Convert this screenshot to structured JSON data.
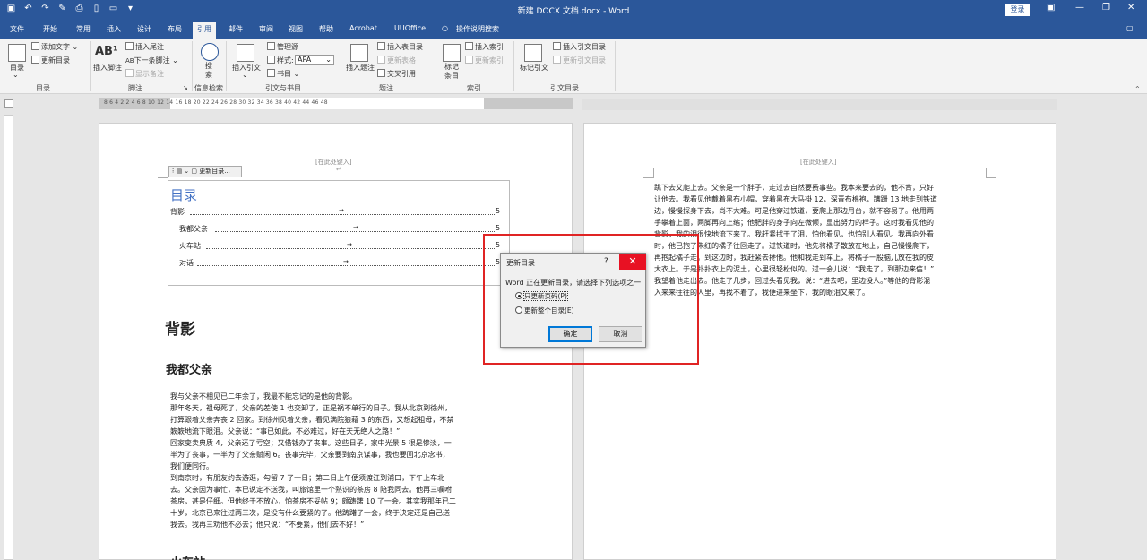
{
  "window": {
    "title": "新建 DOCX 文档.docx  -  Word",
    "login_label": "登录",
    "qat_icons": [
      "save-icon",
      "undo-icon",
      "redo-icon",
      "format-painter-icon",
      "print-preview-icon",
      "new-doc-icon",
      "open-icon",
      "more-icon"
    ]
  },
  "tabs": [
    "文件",
    "开始",
    "常用",
    "插入",
    "设计",
    "布局",
    "引用",
    "邮件",
    "审阅",
    "视图",
    "帮助",
    "Acrobat",
    "UUOffice",
    "操作说明搜索"
  ],
  "active_tab": "引用",
  "ribbon": {
    "toc": {
      "big_label": "目录",
      "add_text": "添加文字",
      "update_toc": "更新目录",
      "group": "目录"
    },
    "footnotes": {
      "insert_footnote": "插入脚注",
      "insert_endnote": "插入尾注",
      "next_footnote": "下一条脚注",
      "show_notes": "显示备注",
      "group": "脚注"
    },
    "research": {
      "search": "搜\n索",
      "group": "信息检索"
    },
    "citations": {
      "insert_citation": "插入引文",
      "manage_sources": "管理源",
      "style_label": "样式:",
      "style_value": "APA",
      "bibliography": "书目",
      "group": "引文与书目"
    },
    "captions": {
      "insert_caption": "插入题注",
      "insert_table_of_figures": "插入表目录",
      "update_table": "更新表格",
      "cross_reference": "交叉引用",
      "group": "题注"
    },
    "index": {
      "mark_entry": "标记\n条目",
      "insert_index": "插入索引",
      "update_index": "更新索引",
      "group": "索引"
    },
    "authorities": {
      "mark_citation": "标记引文",
      "insert_toa": "插入引文目录",
      "update_toa": "更新引文目录",
      "group": "引文目录"
    }
  },
  "ruler": {
    "ticks": "8  6  4  2     2  4  6  8  10  12  14  16  18  20  22  24  26  28  30  32  34  36  38     40  42  44  46  48"
  },
  "page1": {
    "header_placeholder": "[在此处键入]",
    "toc_toolbar_label": "更新目录...",
    "toc_title": "目录",
    "toc_entries": [
      {
        "text": "背影",
        "page": "5"
      },
      {
        "text": "我都父亲",
        "page": "5"
      },
      {
        "text": "火车站",
        "page": "5"
      },
      {
        "text": "对话",
        "page": "5"
      }
    ],
    "heading1": "背影",
    "heading2": "我都父亲",
    "body": "我与父亲不相见已二年余了，我最不能忘记的是他的背影。\n那年冬天，祖母死了，父亲的差使 1 也交卸了，正是祸不单行的日子。我从北京到徐州，\n打算跟着父亲奔丧 2 回家。到徐州见着父亲，看见满院狼藉 3 的东西，又想起祖母，不禁\n簌簌地流下眼泪。父亲说：“事已如此，不必难过，好在天无绝人之路！”\n回家变卖典质 4，父亲还了亏空；又借钱办了丧事。这些日子，家中光景 5 很是惨淡，一\n半为了丧事，一半为了父亲赋闲 6。丧事完毕，父亲要到南京谋事，我也要回北京念书，\n我们便同行。\n到南京时，有朋友约去游逛，勾留 7 了一日；第二日上午便须渡江到浦口，下午上车北\n去。父亲因为事忙，本已说定不送我，叫旅馆里一个熟识的茶房 8 陪我同去。他再三嘱咐\n茶房，甚是仔细。但他终于不放心，怕茶房不妥帖 9；颇踌躇 10 了一会。其实我那年已二\n十岁，北京已来往过两三次，是没有什么要紧的了。他踌躇了一会，终于决定还是自己送\n我去。我再三劝他不必去；他只说：“不要紧，他们去不好！”",
    "heading3": "火车站"
  },
  "page2": {
    "header_placeholder": "[在此处键入]",
    "body": "跳下去又爬上去。父亲是一个胖子，走过去自然要费事些。我本来要去的，他不肯，只好\n让他去。我看见他戴着黑布小帽，穿着黑布大马褂 12，深青布棉袍，蹒跚 13 地走到铁道\n边，慢慢探身下去，尚不大难。可是他穿过铁道，要爬上那边月台，就不容易了。他用两\n手攀着上面，两脚再向上缩；他肥胖的身子向左微倾，显出努力的样子。这时我看见他的\n背影，我的泪很快地流下来了。我赶紧拭干了泪，怕他看见，也怕别人看见。我再向外看\n时，他已抱了朱红的橘子往回走了。过铁道时，他先将橘子散放在地上，自己慢慢爬下，\n再抱起橘子走。到这边时，我赶紧去搀他。他和我走到车上，将橘子一股脑儿放在我的皮\n大衣上。于是扑扑衣上的泥土，心里很轻松似的。过一会儿说：“我走了，到那边来信！”\n我望着他走出去。他走了几步，回过头看见我，说：“进去吧，里边没人。”等他的背影混\n入来来往往的人里，再找不着了，我便进来坐下，我的眼泪又来了。"
  },
  "dialog": {
    "title": "更新目录",
    "help": "?",
    "close": "✕",
    "message": "Word 正在更新目录，请选择下列选项之一:",
    "option1": "只更新页码(P)",
    "option2": "更新整个目录(E)",
    "selected": "option1",
    "ok": "确定",
    "cancel": "取消"
  }
}
